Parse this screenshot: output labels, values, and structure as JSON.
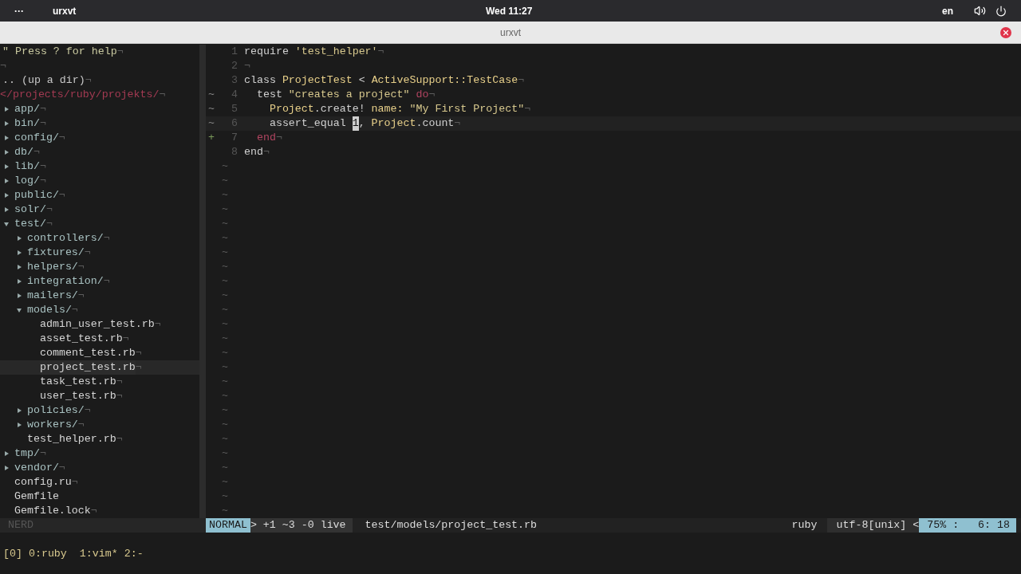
{
  "topbar": {
    "menu": "···",
    "app": "urxvt",
    "clock": "Wed 11:27",
    "lang": "en"
  },
  "window": {
    "title": "urxvt"
  },
  "tree": {
    "header": [
      {
        "kind": "help",
        "text": "\" Press ? for help",
        "eol": "¬"
      },
      {
        "kind": "blank",
        "eol": "¬"
      },
      {
        "kind": "updir",
        "text": ".. (up a dir)",
        "eol": "¬"
      },
      {
        "kind": "path",
        "text": "</projects/ruby/projekts/",
        "eol": "¬"
      }
    ],
    "nodes": [
      {
        "kind": "dir",
        "name": "app/",
        "eol": "¬",
        "expanded": false,
        "selected": false
      },
      {
        "kind": "dir",
        "name": "bin/",
        "eol": "¬",
        "expanded": false,
        "selected": false
      },
      {
        "kind": "dir",
        "name": "config/",
        "eol": "¬",
        "expanded": false,
        "selected": false
      },
      {
        "kind": "dir",
        "name": "db/",
        "eol": "¬",
        "expanded": false,
        "selected": false
      },
      {
        "kind": "dir",
        "name": "lib/",
        "eol": "¬",
        "expanded": false,
        "selected": false
      },
      {
        "kind": "dir",
        "name": "log/",
        "eol": "¬",
        "expanded": false,
        "selected": false
      },
      {
        "kind": "dir",
        "name": "public/",
        "eol": "¬",
        "expanded": false,
        "selected": false
      },
      {
        "kind": "dir",
        "name": "solr/",
        "eol": "¬",
        "expanded": false,
        "selected": false
      },
      {
        "kind": "dir",
        "name": "test/",
        "eol": "¬",
        "expanded": true,
        "selected": false,
        "children": [
          {
            "kind": "dir",
            "name": "controllers/",
            "eol": "¬",
            "expanded": false,
            "selected": false
          },
          {
            "kind": "dir",
            "name": "fixtures/",
            "eol": "¬",
            "expanded": false,
            "selected": false
          },
          {
            "kind": "dir",
            "name": "helpers/",
            "eol": "¬",
            "expanded": false,
            "selected": false
          },
          {
            "kind": "dir",
            "name": "integration/",
            "eol": "¬",
            "expanded": false,
            "selected": false
          },
          {
            "kind": "dir",
            "name": "mailers/",
            "eol": "¬",
            "expanded": false,
            "selected": false
          },
          {
            "kind": "dir",
            "name": "models/",
            "eol": "¬",
            "expanded": true,
            "selected": false,
            "children": [
              {
                "kind": "file",
                "name": "admin_user_test.rb",
                "eol": "¬",
                "selected": false
              },
              {
                "kind": "file",
                "name": "asset_test.rb",
                "eol": "¬",
                "selected": false
              },
              {
                "kind": "file",
                "name": "comment_test.rb",
                "eol": "¬",
                "selected": false
              },
              {
                "kind": "file",
                "name": "project_test.rb",
                "eol": "¬",
                "selected": true
              },
              {
                "kind": "file",
                "name": "task_test.rb",
                "eol": "¬",
                "selected": false
              },
              {
                "kind": "file",
                "name": "user_test.rb",
                "eol": "¬",
                "selected": false
              }
            ]
          },
          {
            "kind": "dir",
            "name": "policies/",
            "eol": "¬",
            "expanded": false,
            "selected": false
          },
          {
            "kind": "dir",
            "name": "workers/",
            "eol": "¬",
            "expanded": false,
            "selected": false
          },
          {
            "kind": "file",
            "name": "test_helper.rb",
            "eol": "¬",
            "selected": false
          }
        ]
      },
      {
        "kind": "dir",
        "name": "tmp/",
        "eol": "¬",
        "expanded": false,
        "selected": false
      },
      {
        "kind": "dir",
        "name": "vendor/",
        "eol": "¬",
        "expanded": false,
        "selected": false
      },
      {
        "kind": "file",
        "name": "config.ru",
        "eol": "¬",
        "selected": false
      },
      {
        "kind": "file",
        "name": "Gemfile",
        "selected": false
      },
      {
        "kind": "file",
        "name": "Gemfile.lock",
        "eol": "¬",
        "selected": false
      }
    ]
  },
  "editor": {
    "lines": [
      {
        "number": "1",
        "tokens": [
          {
            "kind": "plain",
            "text": "require "
          },
          {
            "kind": "string",
            "text": "'test_helper'"
          },
          {
            "kind": "eol",
            "text": "¬"
          }
        ]
      },
      {
        "number": "2",
        "tokens": [
          {
            "kind": "eol",
            "text": "¬"
          }
        ]
      },
      {
        "number": "3",
        "tokens": [
          {
            "kind": "plain",
            "text": "class "
          },
          {
            "kind": "const",
            "text": "ProjectTest"
          },
          {
            "kind": "plain",
            "text": " < "
          },
          {
            "kind": "const",
            "text": "ActiveSupport::TestCase"
          },
          {
            "kind": "eol",
            "text": "¬"
          }
        ]
      },
      {
        "number": "4",
        "sign": "~",
        "tokens": [
          {
            "kind": "plain",
            "text": "  test "
          },
          {
            "kind": "string",
            "text": "\"creates a project\""
          },
          {
            "kind": "keyword",
            "text": " do"
          },
          {
            "kind": "eol",
            "text": "¬"
          }
        ]
      },
      {
        "number": "5",
        "sign": "~",
        "tokens": [
          {
            "kind": "const",
            "text": "    Project"
          },
          {
            "kind": "plain",
            "text": ".create! "
          },
          {
            "kind": "const",
            "text": "name:"
          },
          {
            "kind": "string",
            "text": " \"My First Project\""
          },
          {
            "kind": "eol",
            "text": "¬"
          }
        ]
      },
      {
        "number": "6",
        "sign": "~",
        "current": true,
        "tokens": [
          {
            "kind": "plain",
            "text": "    assert_equal "
          },
          {
            "kind": "cursor",
            "text": "1"
          },
          {
            "kind": "plain",
            "text": ", "
          },
          {
            "kind": "const",
            "text": "Project"
          },
          {
            "kind": "plain",
            "text": ".count"
          },
          {
            "kind": "eol",
            "text": "¬"
          }
        ]
      },
      {
        "number": "7",
        "sign": "+",
        "tokens": [
          {
            "kind": "keyword",
            "text": "  end"
          },
          {
            "kind": "eol",
            "text": "¬"
          }
        ]
      },
      {
        "number": "8",
        "tokens": [
          {
            "kind": "plain",
            "text": "end"
          },
          {
            "kind": "eol",
            "text": "¬"
          }
        ]
      }
    ],
    "filler": [
      "~",
      "~",
      "~",
      "~",
      "~",
      "~",
      "~",
      "~",
      "~",
      "~",
      "~",
      "~",
      "~",
      "~",
      "~",
      "~",
      "~",
      "~",
      "~",
      "~",
      "~",
      "~",
      "~",
      "~",
      "~"
    ]
  },
  "statusline": {
    "sidebar": "NERD",
    "mode": "NORMAL",
    "sep": ">",
    "diff": "+1 ~3 -0 live",
    "file": "test/models/project_test.rb",
    "filetype": "ruby",
    "encoding": "utf-8[unix]",
    "sep_right": "<",
    "percent": "75% :",
    "position": "6: 18"
  },
  "tmux": {
    "session": "[0]",
    "windows": [
      "0:ruby",
      "1:vim*",
      "2:-"
    ]
  }
}
